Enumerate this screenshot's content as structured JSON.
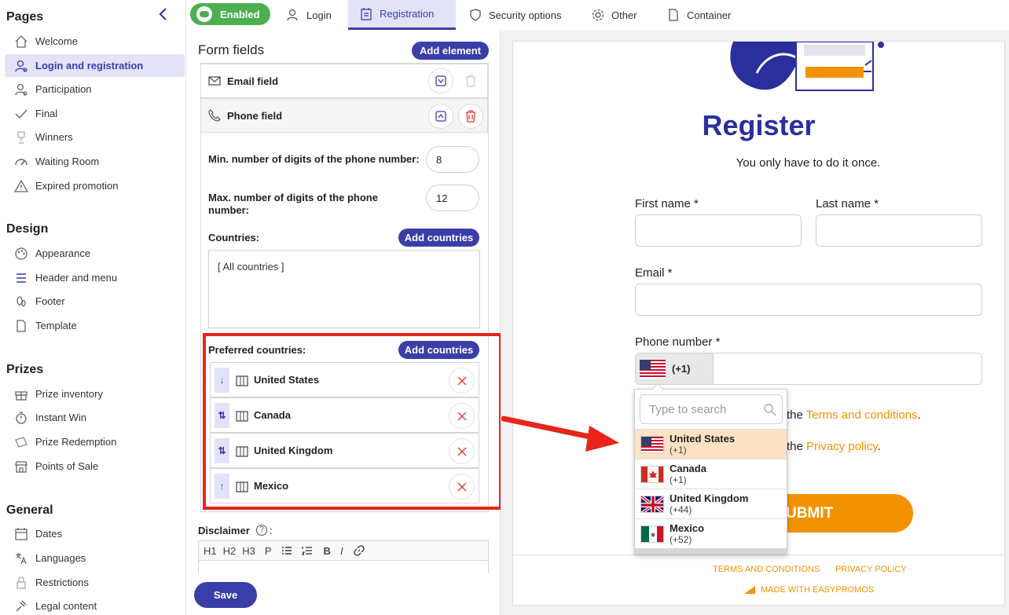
{
  "sidebar": {
    "pages_title": "Pages",
    "pages": [
      "Welcome",
      "Login and registration",
      "Participation",
      "Final",
      "Winners",
      "Waiting Room",
      "Expired promotion"
    ],
    "design_title": "Design",
    "design": [
      "Appearance",
      "Header and menu",
      "Footer",
      "Template"
    ],
    "prizes_title": "Prizes",
    "prizes": [
      "Prize inventory",
      "Instant Win",
      "Prize Redemption",
      "Points of Sale"
    ],
    "general_title": "General",
    "general": [
      "Dates",
      "Languages",
      "Restrictions",
      "Legal content"
    ]
  },
  "tabs": {
    "enabled": "Enabled",
    "items": [
      "Login",
      "Registration",
      "Security options",
      "Other",
      "Container"
    ]
  },
  "form": {
    "title": "Form fields",
    "add_element": "Add element",
    "email_field": "Email field",
    "phone_field": "Phone field",
    "min_label": "Min. number of digits of the phone number:",
    "min_value": "8",
    "max_label_1": "Max. number of digits of the phone",
    "max_label_2": "number:",
    "max_value": "12",
    "countries_label": "Countries:",
    "add_countries": "Add countries",
    "countries_value": "[ All countries ]",
    "preferred_label": "Preferred countries:",
    "preferred": [
      "United States",
      "Canada",
      "United Kingdom",
      "Mexico"
    ],
    "disclaimer": "Disclaimer",
    "toolbar": [
      "H1",
      "H2",
      "H3",
      "P"
    ],
    "save": "Save"
  },
  "preview": {
    "title": "Register",
    "subtitle": "You only have to do it once.",
    "first_name": "First name *",
    "last_name": "Last name *",
    "email": "Email *",
    "phone": "Phone number *",
    "phone_code": "(+1)",
    "search_placeholder": "Type to search",
    "terms_prefix": "the",
    "terms_link": "Terms and conditions",
    "privacy_prefix": "the",
    "privacy_link": "Privacy policy",
    "submit": "UBMIT",
    "footer_terms": "TERMS AND CONDITIONS",
    "footer_privacy": "PRIVACY POLICY",
    "made_with": "MADE WITH EASYPROMOS",
    "dropdown": [
      {
        "name": "United States",
        "code": "(+1)"
      },
      {
        "name": "Canada",
        "code": "(+1)"
      },
      {
        "name": "United Kingdom",
        "code": "(+44)"
      },
      {
        "name": "Mexico",
        "code": "(+52)"
      }
    ]
  },
  "colors": {
    "accent": "#3a3ea8",
    "orange": "#f39200",
    "red_highlight": "#e8241b",
    "enabled_green": "#4caf50"
  }
}
